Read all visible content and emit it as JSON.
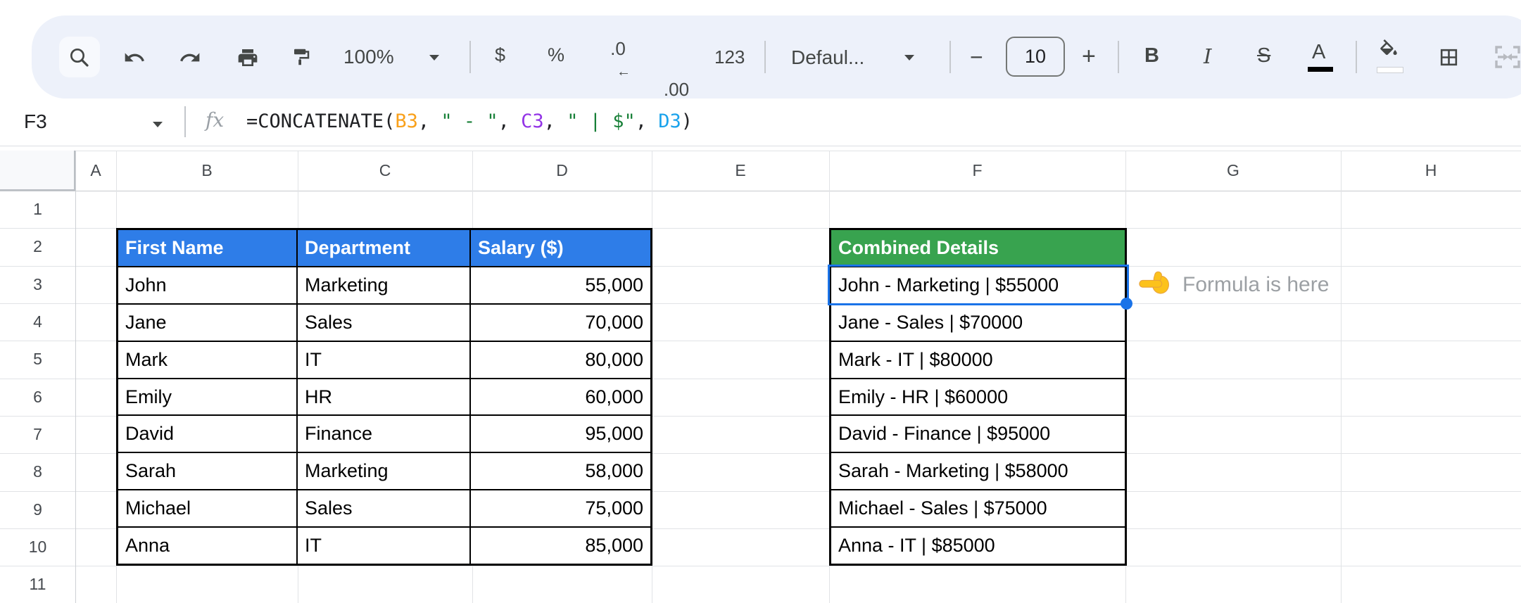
{
  "toolbar": {
    "zoom": "100%",
    "currency": "$",
    "percent": "%",
    "decrease_decimal": ".0",
    "increase_decimal": ".00",
    "more_formats": "123",
    "font_name": "Defaul...",
    "font_size": "10",
    "decrease_font_size": "−",
    "increase_font_size": "+",
    "bold": "B",
    "italic": "I",
    "strikethrough": "S",
    "text_color": "A"
  },
  "formula_bar": {
    "cell_reference": "F3",
    "fx_label": "fx",
    "formula_tokens": [
      {
        "t": "=CONCATENATE(",
        "c": "#202124"
      },
      {
        "t": "B3",
        "c": "#F9A11B"
      },
      {
        "t": ", ",
        "c": "#202124"
      },
      {
        "t": "\" - \"",
        "c": "#188038"
      },
      {
        "t": ", ",
        "c": "#202124"
      },
      {
        "t": "C3",
        "c": "#9334E6"
      },
      {
        "t": ", ",
        "c": "#202124"
      },
      {
        "t": "\" | $\"",
        "c": "#188038"
      },
      {
        "t": ", ",
        "c": "#202124"
      },
      {
        "t": "D3",
        "c": "#1BA3EC"
      },
      {
        "t": ")",
        "c": "#202124"
      }
    ]
  },
  "grid": {
    "column_headers": [
      "A",
      "B",
      "C",
      "D",
      "E",
      "F",
      "G",
      "H"
    ],
    "row_headers": [
      "1",
      "2",
      "3",
      "4",
      "5",
      "6",
      "7",
      "8",
      "9",
      "10",
      "11"
    ]
  },
  "employee_table": {
    "headers": [
      "First Name",
      "Department",
      "Salary ($)"
    ],
    "header_bg": "#2E7DE8",
    "rows": [
      [
        "John",
        "Marketing",
        "55,000"
      ],
      [
        "Jane",
        "Sales",
        "70,000"
      ],
      [
        "Mark",
        "IT",
        "80,000"
      ],
      [
        "Emily",
        "HR",
        "60,000"
      ],
      [
        "David",
        "Finance",
        "95,000"
      ],
      [
        "Sarah",
        "Marketing",
        "58,000"
      ],
      [
        "Michael",
        "Sales",
        "75,000"
      ],
      [
        "Anna",
        "IT",
        "85,000"
      ]
    ]
  },
  "combined_table": {
    "header": "Combined Details",
    "header_bg": "#38A34F",
    "rows": [
      "John - Marketing | $55000",
      "Jane - Sales | $70000",
      "Mark - IT | $80000",
      "Emily - HR | $60000",
      "David - Finance | $95000",
      "Sarah - Marketing | $58000",
      "Michael - Sales | $75000",
      "Anna - IT | $85000"
    ]
  },
  "selection": {
    "cell": "F3",
    "color": "#1A73E8"
  },
  "annotation": {
    "icon": "pointing-left-hand",
    "text": "Formula is here",
    "color": "#9CA0A4"
  }
}
